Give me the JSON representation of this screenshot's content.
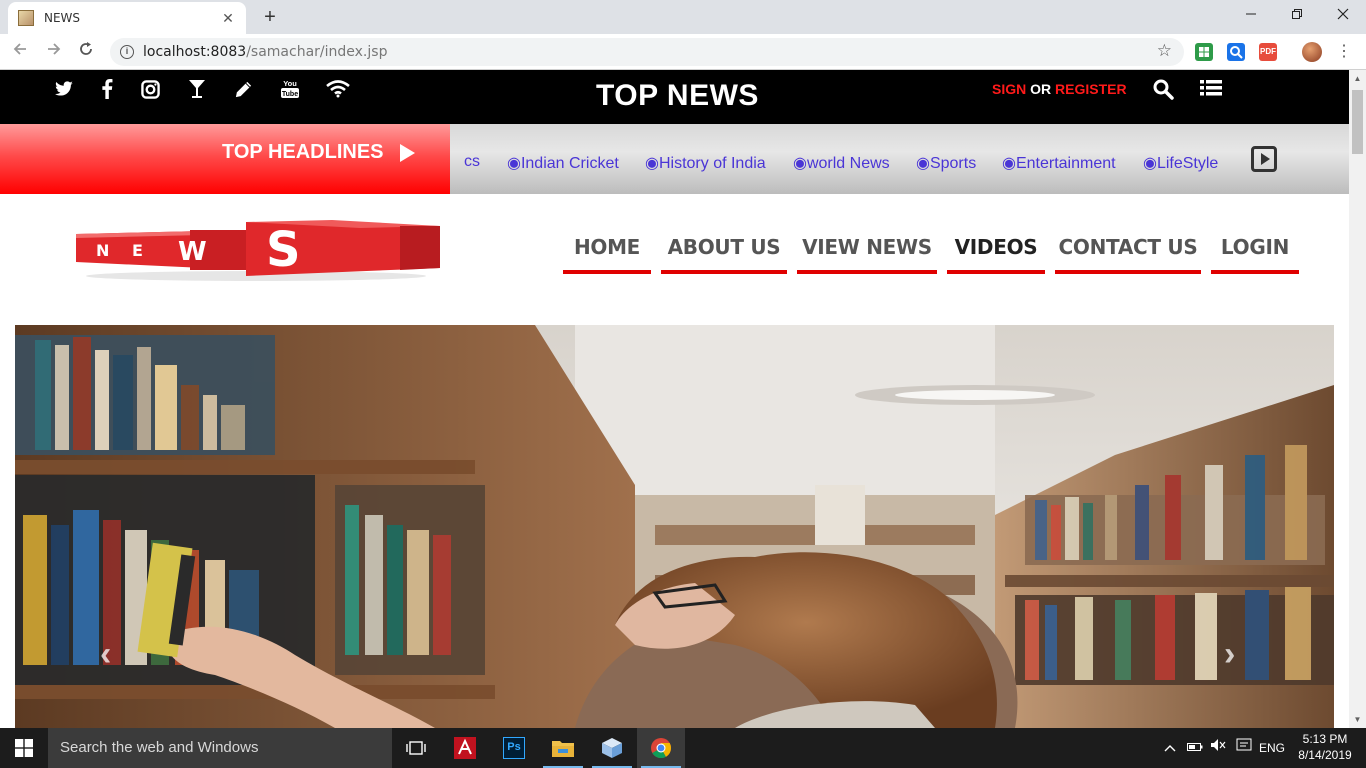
{
  "browser": {
    "tab_title": "NEWS",
    "tab_close": "✕",
    "new_tab": "+",
    "url_host": "localhost:8083",
    "url_path": "/samachar/index.jsp",
    "extensions": [
      "sheets-icon",
      "search-extension-icon",
      "pdf-extension-icon"
    ],
    "pdf_label": "PDF"
  },
  "topbar": {
    "social_icons": [
      "twitter-icon",
      "facebook-icon",
      "instagram-icon",
      "cocktail-icon",
      "pencil-icon",
      "youtube-icon",
      "wifi-icon"
    ],
    "youtube_label": "You Tube",
    "title": "TOP NEWS",
    "sign_label": "SIGN",
    "or_label": "OR",
    "register_label": "REGISTER"
  },
  "headlines": {
    "label": "TOP HEADLINES",
    "items": [
      "cs",
      "◉Indian Cricket",
      "◉History of India",
      "◉world News",
      "◉Sports",
      "◉Entertainment",
      "◉LifeStyle"
    ]
  },
  "logo": {
    "letters": [
      "N",
      "E",
      "W",
      "S"
    ],
    "colors": {
      "red": "#e0282b",
      "dark_red": "#b81c20"
    }
  },
  "nav": {
    "items": [
      "HOME",
      "ABOUT US",
      "VIEW NEWS",
      "VIDEOS",
      "CONTACT US",
      "LOGIN"
    ],
    "active": "VIDEOS",
    "accent": "#e00000"
  },
  "hero": {
    "prev_label": "‹",
    "next_label": "›"
  },
  "taskbar": {
    "search_placeholder": "Search the web and Windows",
    "apps": [
      "task-view-icon",
      "adobe-acrobat-icon",
      "photoshop-icon",
      "file-explorer-icon",
      "box-app-icon",
      "chrome-icon"
    ],
    "photoshop_label": "Ps",
    "language": "ENG",
    "time": "5:13 PM",
    "date": "8/14/2019"
  }
}
